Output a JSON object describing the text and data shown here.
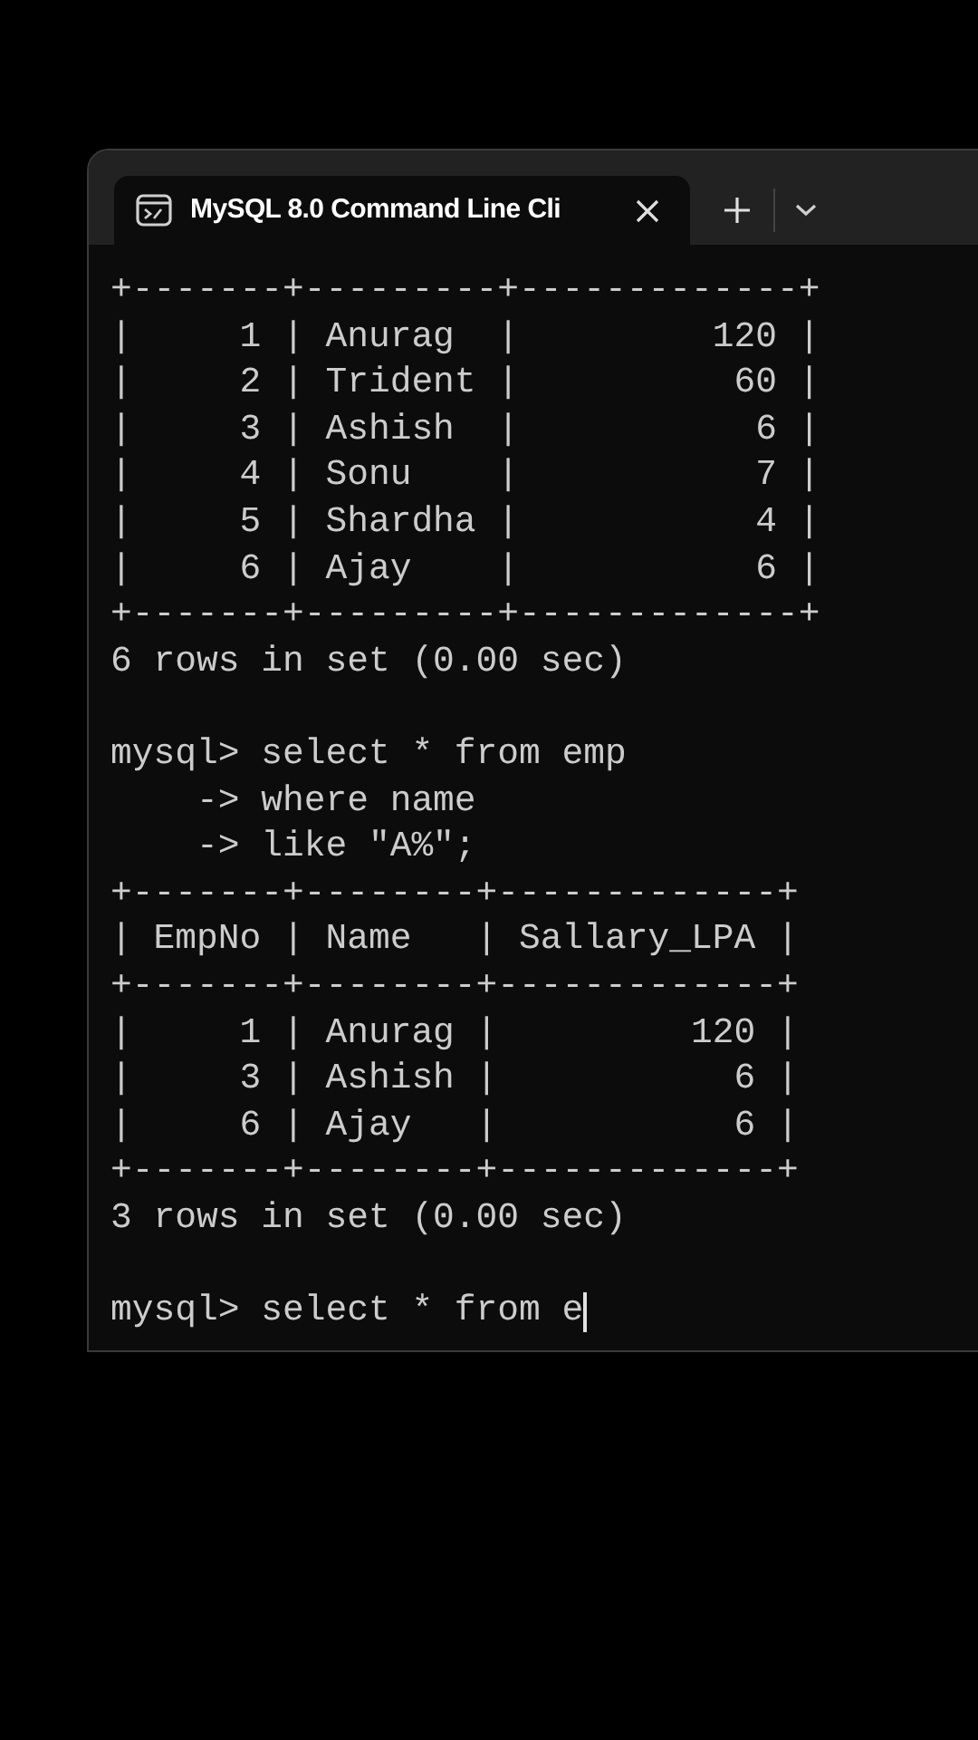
{
  "window": {
    "tab": {
      "title": "MySQL 8.0 Command Line Cli",
      "selected": true
    }
  },
  "terminal": {
    "blocks": [
      [
        "+-------+---------+-------------+",
        "|     1 | Anurag  |         120 |",
        "|     2 | Trident |          60 |",
        "|     3 | Ashish  |           6 |",
        "|     4 | Sonu    |           7 |",
        "|     5 | Shardha |           4 |",
        "|     6 | Ajay    |           6 |",
        "+-------+---------+-------------+",
        "6 rows in set (0.00 sec)"
      ],
      [
        "mysql> select * from emp",
        "    -> where name",
        "    -> like \"A%\";",
        "+-------+--------+-------------+",
        "| EmpNo | Name   | Sallary_LPA |",
        "+-------+--------+-------------+",
        "|     1 | Anurag |         120 |",
        "|     3 | Ashish |           6 |",
        "|     6 | Ajay   |           6 |",
        "+-------+--------+-------------+",
        "3 rows in set (0.00 sec)"
      ],
      [
        "mysql> select * from e"
      ]
    ],
    "cursor": true
  }
}
